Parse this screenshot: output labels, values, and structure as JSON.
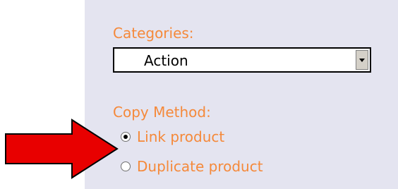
{
  "form": {
    "categories_label": "Categories:",
    "category_select": {
      "selected": "Action"
    },
    "copy_method_label": "Copy Method:",
    "copy_method_options": [
      {
        "label": "Link product",
        "checked": true
      },
      {
        "label": "Duplicate product",
        "checked": false
      }
    ]
  },
  "annotation": {
    "arrow_icon": "right-arrow-icon",
    "arrow_color": "#e80000"
  },
  "colors": {
    "label_text": "#f5893a",
    "panel_bg": "#e4e4f0"
  }
}
